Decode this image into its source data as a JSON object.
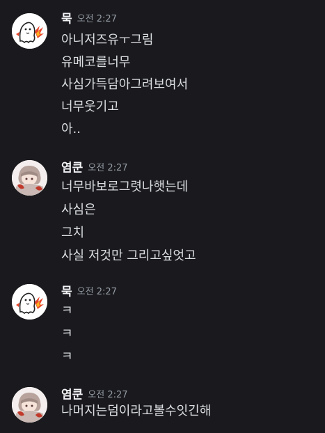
{
  "messages": [
    {
      "author": "묵",
      "timestamp": "오전 2:27",
      "avatar_icon": "ghost-with-fire-avatar",
      "lines": [
        "아니저즈유ㅜ그림",
        "유메코를너무",
        "사심가득담아그려보여서",
        "너무웃기고",
        "아.."
      ]
    },
    {
      "author": "염쿤",
      "timestamp": "오전 2:27",
      "avatar_icon": "anime-character-avatar",
      "lines": [
        "너무바보로그렷나햇는데",
        "사심은",
        "그치",
        "사실 저것만 그리고싶엇고"
      ]
    },
    {
      "author": "묵",
      "timestamp": "오전 2:27",
      "avatar_icon": "ghost-with-fire-avatar",
      "lines": [
        "ㅋ",
        "ㅋ",
        "ㅋ"
      ]
    },
    {
      "author": "염쿤",
      "timestamp": "오전 2:27",
      "avatar_icon": "anime-character-avatar",
      "lines": [
        "나머지는덤이라고볼수잇긴해"
      ]
    }
  ],
  "colors": {
    "background": "#1a1a1e",
    "author": "#f2f3f5",
    "timestamp": "#949ba4",
    "text": "#dbdee1"
  }
}
